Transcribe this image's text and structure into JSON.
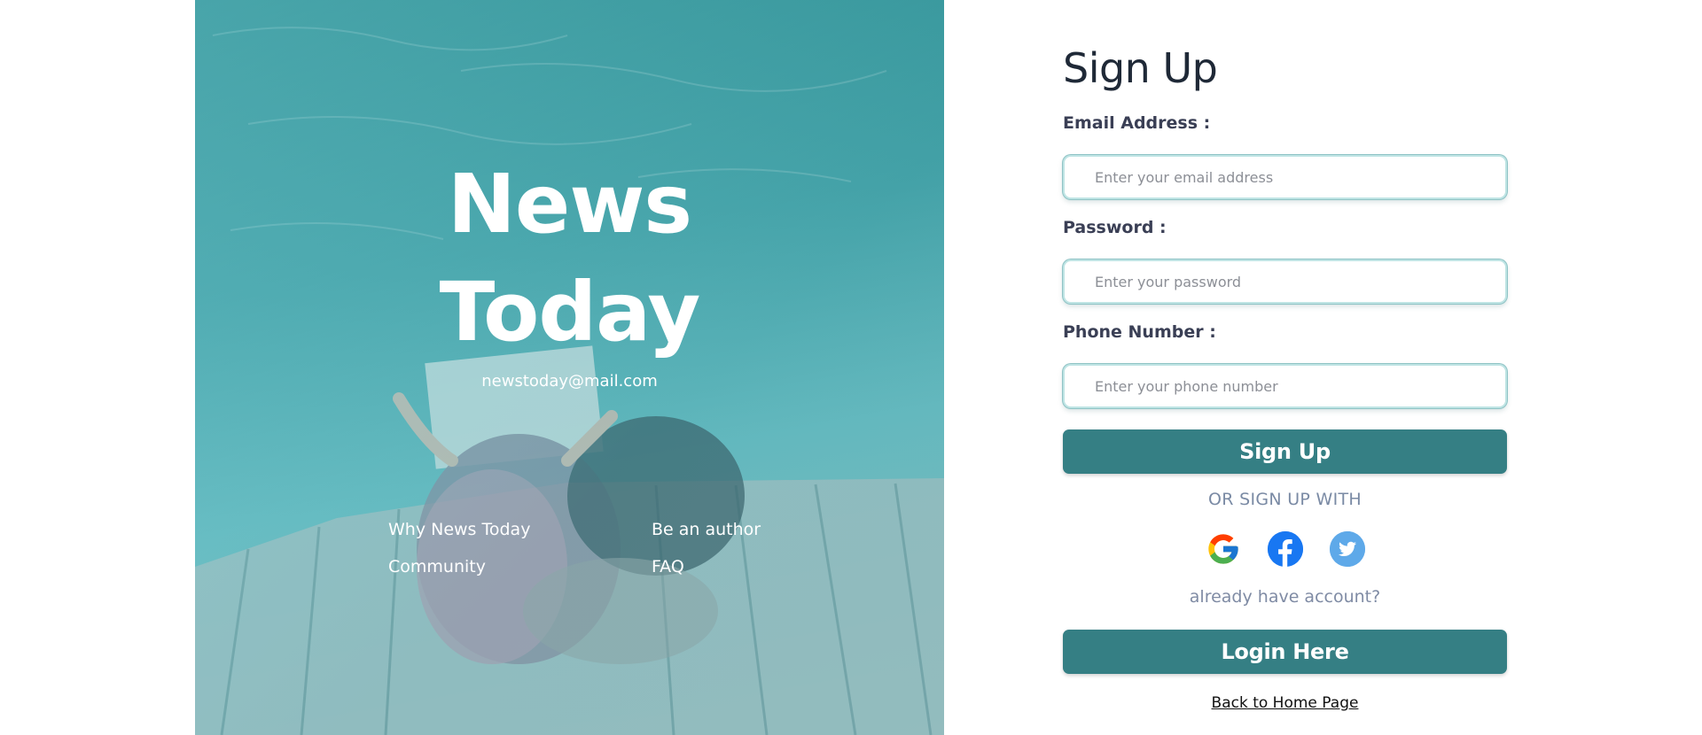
{
  "hero": {
    "brand_line1": "News",
    "brand_line2": "Today",
    "email": "newstoday@mail.com",
    "links": [
      "Why News Today",
      "Be an author",
      "Community",
      "FAQ"
    ]
  },
  "form": {
    "title": "Sign Up",
    "email_label": "Email Address :",
    "email_placeholder": "Enter your email address",
    "password_label": "Password :",
    "password_placeholder": "Enter your password",
    "phone_label": "Phone Number :",
    "phone_placeholder": "Enter your phone number",
    "signup_button": "Sign Up",
    "or_text": "OR SIGN UP WITH",
    "social": [
      "google-icon",
      "facebook-icon",
      "twitter-icon"
    ],
    "already_text": "already have account?",
    "login_button": "Login Here",
    "back_link": "Back to Home Page"
  },
  "colors": {
    "accent": "#357f84",
    "hero_teal": "#48a5ab",
    "facebook": "#1877f2",
    "twitter": "#5ea9e9"
  }
}
